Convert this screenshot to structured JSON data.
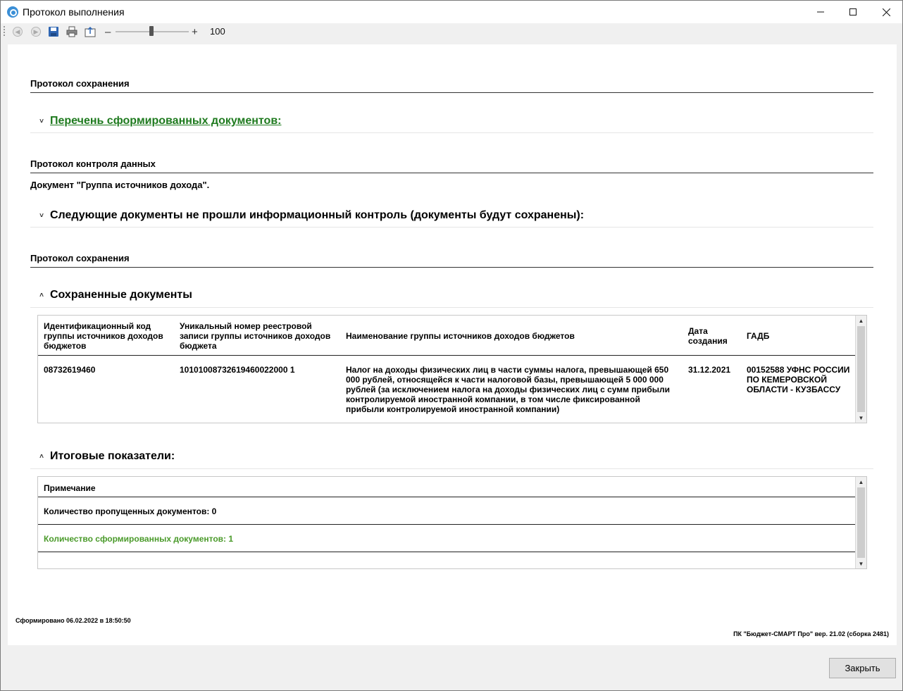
{
  "window": {
    "title": "Протокол выполнения"
  },
  "toolbar": {
    "zoom_value": "100"
  },
  "sections": {
    "save_protocol_1": "Протокол сохранения",
    "formed_docs_link": "Перечень сформированных документов:",
    "control_protocol": "Протокол контроля данных",
    "document_line": "Документ \"Группа источников дохода\".",
    "failed_control": "Следующие документы не прошли информационный контроль (документы будут сохранены):",
    "save_protocol_2": "Протокол сохранения",
    "saved_docs": "Сохраненные документы",
    "totals": "Итоговые показатели:"
  },
  "saved_table": {
    "headers": [
      "Идентификационный код группы источников доходов бюджетов",
      "Уникальный номер реестровой записи группы источников доходов бюджета",
      "Наименование группы источников доходов бюджетов",
      "Дата создания",
      "ГАДБ"
    ],
    "rows": [
      [
        "08732619460",
        "10101008732619460022000 1",
        "Налог на доходы физических лиц в части суммы налога, превышающей 650 000 рублей, относящейся к части налоговой базы, превышающей 5 000 000 рублей (за исключением налога на доходы физических лиц с сумм прибыли контролируемой иностранной компании, в том числе фиксированной прибыли контролируемой иностранной компании)",
        "31.12.2021",
        "00152588 УФНС РОССИИ ПО КЕМЕРОВСКОЙ ОБЛАСТИ - КУЗБАССУ"
      ]
    ]
  },
  "totals_table": {
    "header": "Примечание",
    "rows": [
      "Количество пропущенных документов: 0",
      "Количество сформированных документов: 1"
    ]
  },
  "footer": {
    "generated": "Сформировано 06.02.2022 в 18:50:50",
    "version": "ПК \"Бюджет-СМАРТ Про\" вер. 21.02 (сборка 2481)"
  },
  "buttons": {
    "close": "Закрыть"
  },
  "colors": {
    "link_green": "#1e7a1e",
    "count_green": "#4a9a2a"
  }
}
